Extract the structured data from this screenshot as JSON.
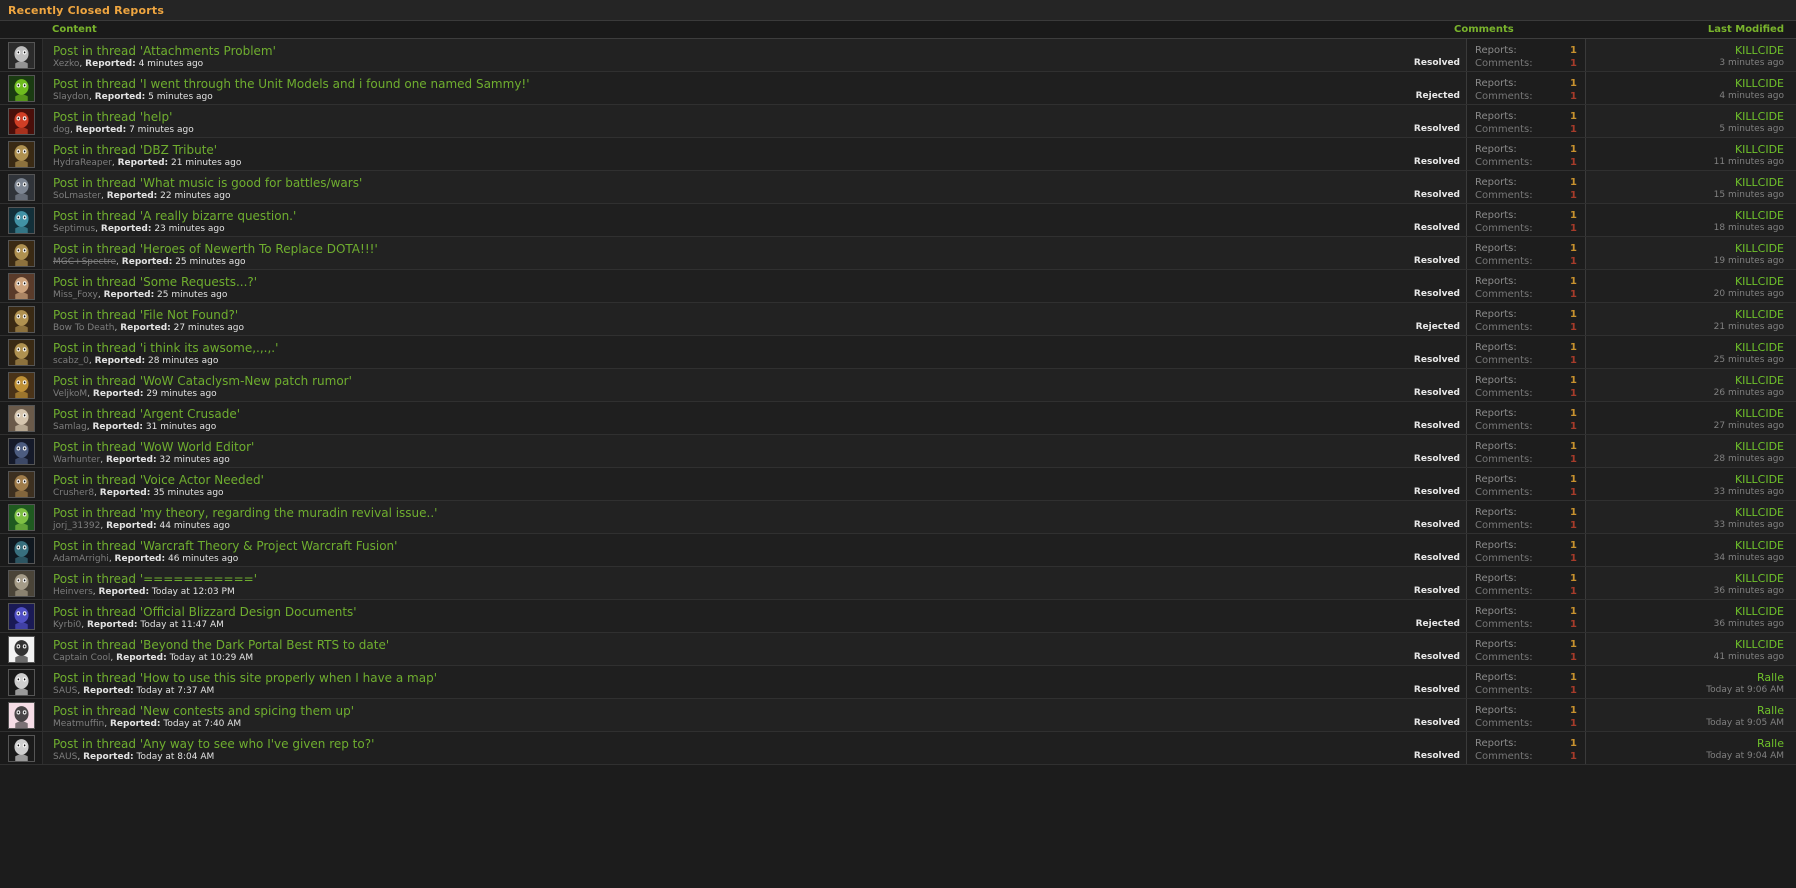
{
  "window": {
    "title": "Recently Closed Reports"
  },
  "colors": {
    "accent_orange": "#f0a640",
    "link_green": "#6fae2f",
    "header_green": "#79b42c",
    "user_green": "#6fc22b",
    "reports_number": "#c8922e",
    "comments_number": "#a63b2a",
    "row_bg": "#222222",
    "page_bg": "#1c1c1c"
  },
  "columns": {
    "avatar": "",
    "content": "Content",
    "comments": "Comments",
    "last_modified": "Last Modified"
  },
  "labels": {
    "reports": "Reports:",
    "comments": "Comments:",
    "reported_prefix": "Reported:"
  },
  "rows": [
    {
      "avatar": "avatar-xezko",
      "title": "Post in thread 'Attachments Problem'",
      "user": "Xezko",
      "user_banned": false,
      "reported": "4 minutes ago",
      "state": "Resolved",
      "reports_count": "1",
      "comments_count": "1",
      "modified_user": "KILLCIDE",
      "modified_time": "3 minutes ago"
    },
    {
      "avatar": "avatar-slaydon",
      "title": "Post in thread 'I went through the Unit Models and i found one named Sammy!'",
      "user": "Slaydon",
      "user_banned": false,
      "reported": "5 minutes ago",
      "state": "Rejected",
      "reports_count": "1",
      "comments_count": "1",
      "modified_user": "KILLCIDE",
      "modified_time": "4 minutes ago"
    },
    {
      "avatar": "avatar-dog",
      "title": "Post in thread 'help'",
      "user": "dog",
      "user_banned": false,
      "reported": "7 minutes ago",
      "state": "Resolved",
      "reports_count": "1",
      "comments_count": "1",
      "modified_user": "KILLCIDE",
      "modified_time": "5 minutes ago"
    },
    {
      "avatar": "avatar-hydrareaper",
      "title": "Post in thread 'DBZ Tribute'",
      "user": "HydraReaper",
      "user_banned": false,
      "reported": "21 minutes ago",
      "state": "Resolved",
      "reports_count": "1",
      "comments_count": "1",
      "modified_user": "KILLCIDE",
      "modified_time": "11 minutes ago"
    },
    {
      "avatar": "avatar-solmaster",
      "title": "Post in thread 'What music is good for battles/wars'",
      "user": "SoLmaster",
      "user_banned": false,
      "reported": "22 minutes ago",
      "state": "Resolved",
      "reports_count": "1",
      "comments_count": "1",
      "modified_user": "KILLCIDE",
      "modified_time": "15 minutes ago"
    },
    {
      "avatar": "avatar-septimus",
      "title": "Post in thread 'A really bizarre question.'",
      "user": "Septimus",
      "user_banned": false,
      "reported": "23 minutes ago",
      "state": "Resolved",
      "reports_count": "1",
      "comments_count": "1",
      "modified_user": "KILLCIDE",
      "modified_time": "18 minutes ago"
    },
    {
      "avatar": "avatar-mgcspectre",
      "title": "Post in thread 'Heroes of Newerth To Replace DOTA!!!'",
      "user": "MGC+Spectre",
      "user_banned": true,
      "reported": "25 minutes ago",
      "state": "Resolved",
      "reports_count": "1",
      "comments_count": "1",
      "modified_user": "KILLCIDE",
      "modified_time": "19 minutes ago"
    },
    {
      "avatar": "avatar-missfoxy",
      "title": "Post in thread 'Some Requests...?'",
      "user": "Miss_Foxy",
      "user_banned": false,
      "reported": "25 minutes ago",
      "state": "Resolved",
      "reports_count": "1",
      "comments_count": "1",
      "modified_user": "KILLCIDE",
      "modified_time": "20 minutes ago"
    },
    {
      "avatar": "avatar-bowtodeath",
      "title": "Post in thread 'File Not Found?'",
      "user": "Bow To Death",
      "user_banned": false,
      "reported": "27 minutes ago",
      "state": "Rejected",
      "reports_count": "1",
      "comments_count": "1",
      "modified_user": "KILLCIDE",
      "modified_time": "21 minutes ago"
    },
    {
      "avatar": "avatar-scabz",
      "title": "Post in thread 'i think its awsome,.,.,.'",
      "user": "scabz_0",
      "user_banned": false,
      "reported": "28 minutes ago",
      "state": "Resolved",
      "reports_count": "1",
      "comments_count": "1",
      "modified_user": "KILLCIDE",
      "modified_time": "25 minutes ago"
    },
    {
      "avatar": "avatar-veljkom",
      "title": "Post in thread 'WoW Cataclysm-New patch rumor'",
      "user": "VeljkoM",
      "user_banned": false,
      "reported": "29 minutes ago",
      "state": "Resolved",
      "reports_count": "1",
      "comments_count": "1",
      "modified_user": "KILLCIDE",
      "modified_time": "26 minutes ago"
    },
    {
      "avatar": "avatar-samlag",
      "title": "Post in thread 'Argent Crusade'",
      "user": "Samlag",
      "user_banned": false,
      "reported": "31 minutes ago",
      "state": "Resolved",
      "reports_count": "1",
      "comments_count": "1",
      "modified_user": "KILLCIDE",
      "modified_time": "27 minutes ago"
    },
    {
      "avatar": "avatar-warhunter",
      "title": "Post in thread 'WoW World Editor'",
      "user": "Warhunter",
      "user_banned": false,
      "reported": "32 minutes ago",
      "state": "Resolved",
      "reports_count": "1",
      "comments_count": "1",
      "modified_user": "KILLCIDE",
      "modified_time": "28 minutes ago"
    },
    {
      "avatar": "avatar-crusher8",
      "title": "Post in thread 'Voice Actor Needed'",
      "user": "Crusher8",
      "user_banned": false,
      "reported": "35 minutes ago",
      "state": "Resolved",
      "reports_count": "1",
      "comments_count": "1",
      "modified_user": "KILLCIDE",
      "modified_time": "33 minutes ago"
    },
    {
      "avatar": "avatar-jorj",
      "title": "Post in thread 'my theory, regarding the muradin revival issue..'",
      "user": "jorj_31392",
      "user_banned": false,
      "reported": "44 minutes ago",
      "state": "Resolved",
      "reports_count": "1",
      "comments_count": "1",
      "modified_user": "KILLCIDE",
      "modified_time": "33 minutes ago"
    },
    {
      "avatar": "avatar-adamarrighi",
      "title": "Post in thread 'Warcraft Theory & Project Warcraft Fusion'",
      "user": "AdamArrighi",
      "user_banned": false,
      "reported": "46 minutes ago",
      "state": "Resolved",
      "reports_count": "1",
      "comments_count": "1",
      "modified_user": "KILLCIDE",
      "modified_time": "34 minutes ago"
    },
    {
      "avatar": "avatar-heinvers",
      "title": "Post in thread '==========='",
      "user": "Heinvers",
      "user_banned": false,
      "reported": "Today at 12:03 PM",
      "state": "Resolved",
      "reports_count": "1",
      "comments_count": "1",
      "modified_user": "KILLCIDE",
      "modified_time": "36 minutes ago"
    },
    {
      "avatar": "avatar-kyrbi0",
      "title": "Post in thread 'Official Blizzard Design Documents'",
      "user": "Kyrbi0",
      "user_banned": false,
      "reported": "Today at 11:47 AM",
      "state": "Rejected",
      "reports_count": "1",
      "comments_count": "1",
      "modified_user": "KILLCIDE",
      "modified_time": "36 minutes ago"
    },
    {
      "avatar": "avatar-captaincool",
      "title": "Post in thread 'Beyond the Dark Portal Best RTS to date'",
      "user": "Captain Cool",
      "user_banned": false,
      "reported": "Today at 10:29 AM",
      "state": "Resolved",
      "reports_count": "1",
      "comments_count": "1",
      "modified_user": "KILLCIDE",
      "modified_time": "41 minutes ago"
    },
    {
      "avatar": "avatar-saus",
      "title": "Post in thread 'How to use this site properly when I have a map'",
      "user": "SAUS",
      "user_banned": false,
      "reported": "Today at 7:37 AM",
      "state": "Resolved",
      "reports_count": "1",
      "comments_count": "1",
      "modified_user": "Ralle",
      "modified_time": "Today at 9:06 AM"
    },
    {
      "avatar": "avatar-meatmuffin",
      "title": "Post in thread 'New contests and spicing them up'",
      "user": "Meatmuffin",
      "user_banned": false,
      "reported": "Today at 7:40 AM",
      "state": "Resolved",
      "reports_count": "1",
      "comments_count": "1",
      "modified_user": "Ralle",
      "modified_time": "Today at 9:05 AM"
    },
    {
      "avatar": "avatar-saus2",
      "title": "Post in thread 'Any way to see who I've given rep to?'",
      "user": "SAUS",
      "user_banned": false,
      "reported": "Today at 8:04 AM",
      "state": "Resolved",
      "reports_count": "1",
      "comments_count": "1",
      "modified_user": "Ralle",
      "modified_time": "Today at 9:04 AM"
    }
  ]
}
